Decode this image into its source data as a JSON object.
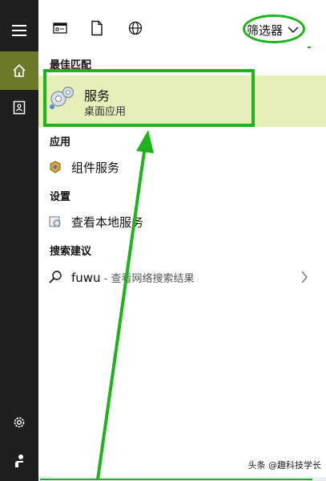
{
  "rail": {
    "items": [
      {
        "icon": "menu-icon"
      },
      {
        "icon": "home-icon"
      },
      {
        "icon": "notebook-icon"
      },
      {
        "icon": "gear-icon"
      },
      {
        "icon": "user-icon"
      }
    ]
  },
  "toolbar": {
    "icons": [
      "app-window-icon",
      "document-icon",
      "globe-icon"
    ],
    "filter_label": "筛选器"
  },
  "results": {
    "best_match_label": "最佳匹配",
    "best_match": {
      "title": "服务",
      "subtitle": "桌面应用"
    },
    "apps_label": "应用",
    "apps": [
      {
        "label": "组件服务"
      }
    ],
    "settings_label": "设置",
    "settings": [
      {
        "label": "查看本地服务"
      }
    ],
    "suggestions_label": "搜索建议",
    "suggestions": [
      {
        "query": "fuwu",
        "suffix": " - 查看网络搜索结果"
      }
    ]
  },
  "watermark": "头条 @趣科技学长",
  "colors": {
    "accent": "#1cb31c",
    "rail": "#1f1f1f",
    "rail_active": "#6e7a2a",
    "highlight": "#e7eeb8"
  }
}
